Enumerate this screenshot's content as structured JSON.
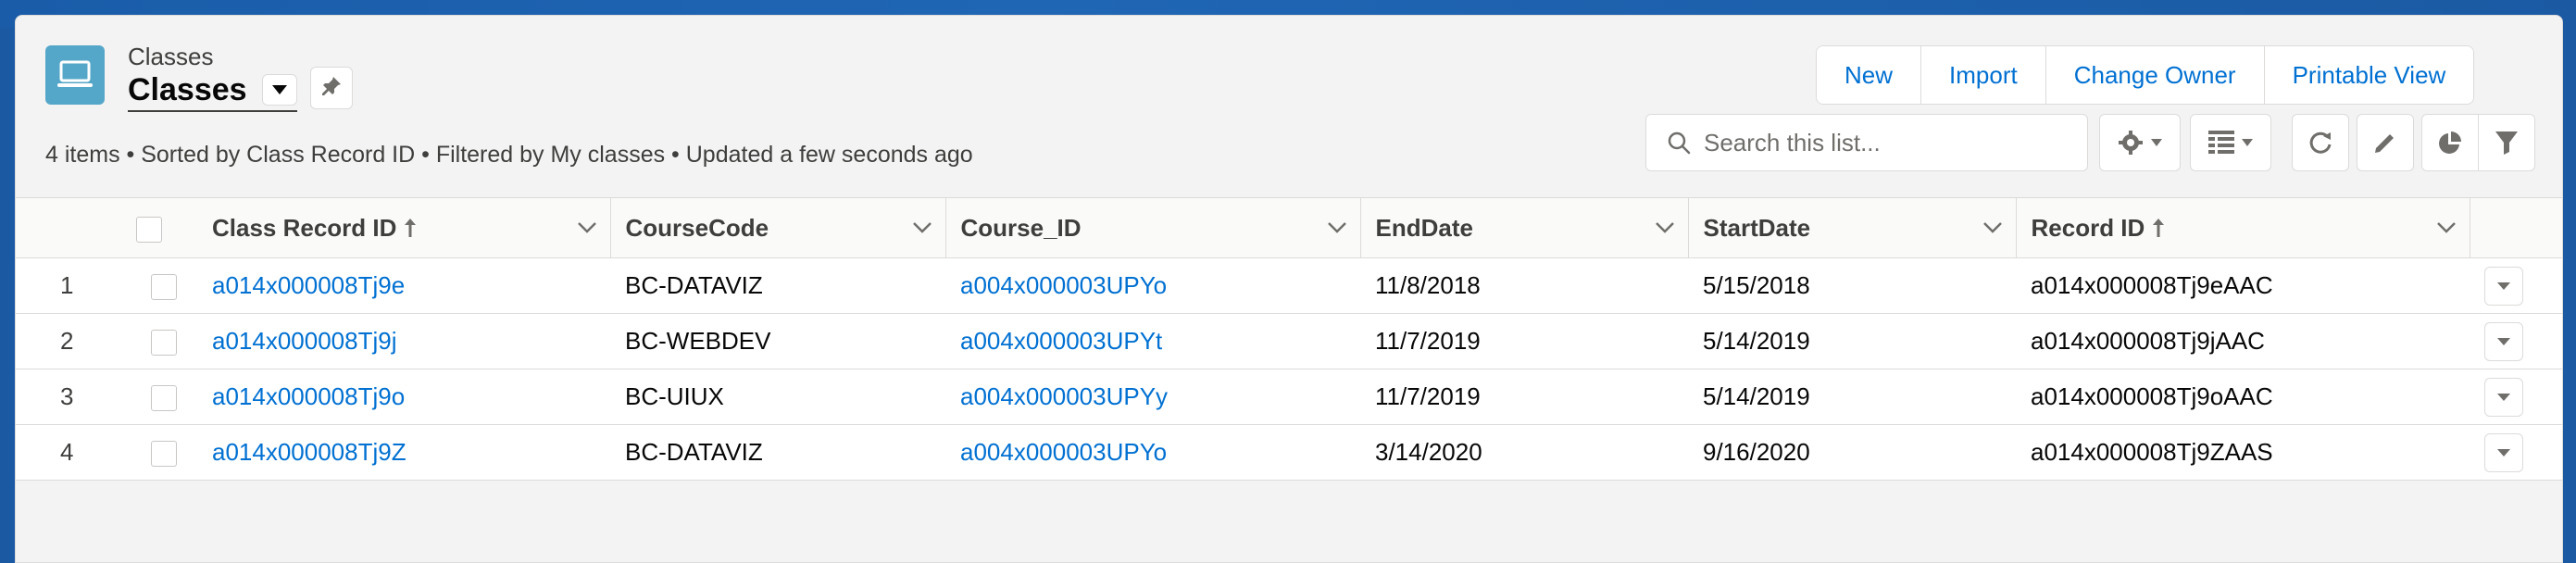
{
  "header": {
    "object_label": "Classes",
    "list_view_name": "Classes",
    "summary": "4 items • Sorted by Class Record ID • Filtered by My classes • Updated a few seconds ago",
    "icons": {
      "object": "laptop-icon",
      "list_switcher": "caret-down-icon",
      "pin": "pin-icon"
    }
  },
  "actions": {
    "buttons": [
      "New",
      "Import",
      "Change Owner",
      "Printable View"
    ]
  },
  "toolbar": {
    "search_placeholder": "Search this list...",
    "icons": [
      "search-icon",
      "gear-icon",
      "table-icon",
      "refresh-icon",
      "pencil-icon",
      "pie-chart-icon",
      "filter-icon"
    ]
  },
  "table": {
    "columns": [
      "Class Record ID",
      "CourseCode",
      "Course_ID",
      "EndDate",
      "StartDate",
      "Record ID"
    ],
    "sorted_columns": [
      "Class Record ID",
      "Record ID"
    ],
    "rows": [
      {
        "num": "1",
        "class_record_id": "a014x000008Tj9e",
        "course_code": "BC-DATAVIZ",
        "course_id": "a004x000003UPYo",
        "end_date": "11/8/2018",
        "start_date": "5/15/2018",
        "record_id": "a014x000008Tj9eAAC"
      },
      {
        "num": "2",
        "class_record_id": "a014x000008Tj9j",
        "course_code": "BC-WEBDEV",
        "course_id": "a004x000003UPYt",
        "end_date": "11/7/2019",
        "start_date": "5/14/2019",
        "record_id": "a014x000008Tj9jAAC"
      },
      {
        "num": "3",
        "class_record_id": "a014x000008Tj9o",
        "course_code": "BC-UIUX",
        "course_id": "a004x000003UPYy",
        "end_date": "11/7/2019",
        "start_date": "5/14/2019",
        "record_id": "a014x000008Tj9oAAC"
      },
      {
        "num": "4",
        "class_record_id": "a014x000008Tj9Z",
        "course_code": "BC-DATAVIZ",
        "course_id": "a004x000003UPYo",
        "end_date": "3/14/2020",
        "start_date": "9/16/2020",
        "record_id": "a014x000008Tj9ZAAS"
      }
    ]
  },
  "colors": {
    "link": "#0070d2",
    "brand_band": "#1b5aa3",
    "object_icon": "#54a7c9"
  }
}
